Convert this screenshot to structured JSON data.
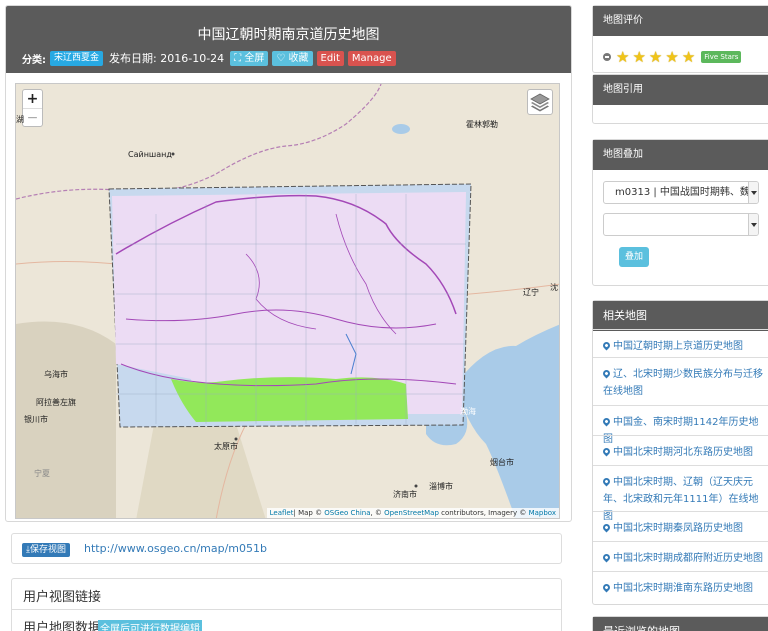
{
  "page": {
    "title": "中国辽朝时期南京道历史地图",
    "category_label": "分类:",
    "category_badge": "宋辽西夏金",
    "date_label": "发布日期:",
    "date": "2016-10-24",
    "fullscreen_btn": "全屏",
    "favorite_btn": "收藏",
    "edit_btn": "Edit",
    "manage_btn": "Manage"
  },
  "map": {
    "zoom_in": "+",
    "zoom_out": "−",
    "labels": {
      "sainshand": "Сайншанд",
      "hulunbuir": "霍林郭勒",
      "liaoning": "辽宁",
      "shen": "沈",
      "wuhai": "乌海市",
      "alxa": "阿拉善左旗",
      "yinchuan": "银川市",
      "taiyuan": "太原市",
      "ningxia": "宁夏",
      "jinan": "济南市",
      "zibo": "淄博市",
      "yantai": "烟台市",
      "bohai": "渤海",
      "hu": "湖"
    },
    "attribution": {
      "leaflet": "Leaflet",
      "map_by": "| Map © ",
      "osgeo": "OSGeo China",
      "sep": ", © ",
      "osm": "OpenStreetMap",
      "contrib": " contributors, Imagery © ",
      "mapbox": "Mapbox"
    }
  },
  "url_panel": {
    "save_btn": "保存视图",
    "url": "http://www.osgeo.cn/map/m051b"
  },
  "links_panel": {
    "view_links": "用户视图链接",
    "map_data": "用户地图数据",
    "data_hint": "全屏后可进行数据编辑"
  },
  "sidebar": {
    "rating": {
      "title": "地图评价",
      "stars": 5,
      "badge": "Five Stars"
    },
    "citation": {
      "title": "地图引用"
    },
    "overlay": {
      "title": "地图叠加",
      "select1": "m0313 | 中国战国时期韩、魏",
      "select2": "",
      "button": "叠加"
    },
    "related": {
      "title": "相关地图",
      "items": [
        "中国辽朝时期上京道历史地图",
        "辽、北宋时期少数民族分布与迁移在线地图",
        "中国金、南宋时期1142年历史地图",
        "中国北宋时期河北东路历史地图",
        "中国北宋时期、辽朝（辽天庆元年、北宋政和元年1111年）在线地图",
        "中国北宋时期秦凤路历史地图",
        "中国北宋时期成都府附近历史地图",
        "中国北宋时期淮南东路历史地图"
      ]
    },
    "recent": {
      "title": "最近浏览的地图"
    }
  },
  "colors": {
    "header_bg": "#5b5b5b",
    "link": "#337ab7",
    "info": "#5bc0de",
    "danger": "#d9534f",
    "success": "#5cb85c",
    "water": "#a9cbe8",
    "land": "#ece6d8",
    "overlay_purple": "#ecdcf4",
    "overlay_green": "#92e85a"
  }
}
